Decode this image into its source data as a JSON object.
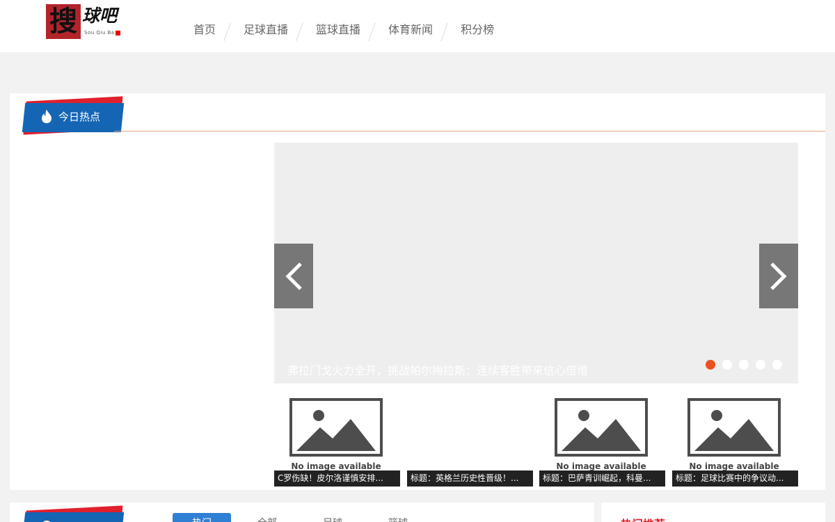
{
  "header": {
    "logo": {
      "char": "搜",
      "text": "球吧",
      "sub": "Sou Qiu Ba"
    },
    "nav": [
      "首页",
      "足球直播",
      "篮球直播",
      "体育新闻",
      "积分榜"
    ]
  },
  "hot": {
    "title": "今日热点",
    "slide_caption": "弗拉门戈火力全开，挑战帕尔梅拉斯：连续客胜带来信心倍增",
    "slide_count": 5,
    "active_slide": 0,
    "thumbs": [
      {
        "caption": "C罗伤缺！皮尔洛谨慎安排...",
        "image": true,
        "image_text": "No image available"
      },
      {
        "caption": "标题：英格兰历史性晋级！...",
        "image": false,
        "image_text": ""
      },
      {
        "caption": "标题：巴萨青训崛起，科曼...",
        "image": true,
        "image_text": "No image available"
      },
      {
        "caption": "标题：足球比赛中的争议动...",
        "image": true,
        "image_text": "No image available"
      }
    ]
  },
  "news": {
    "tabs": [
      "热门",
      "全部",
      "足球",
      "篮球"
    ],
    "active_tab": 0
  },
  "recommend": {
    "title": "热门推荐"
  },
  "colors": {
    "accent_blue": "#1565b5",
    "accent_red": "#e0202d",
    "dot_active": "#ee4f1f",
    "tab_active": "#2f7fd4"
  }
}
